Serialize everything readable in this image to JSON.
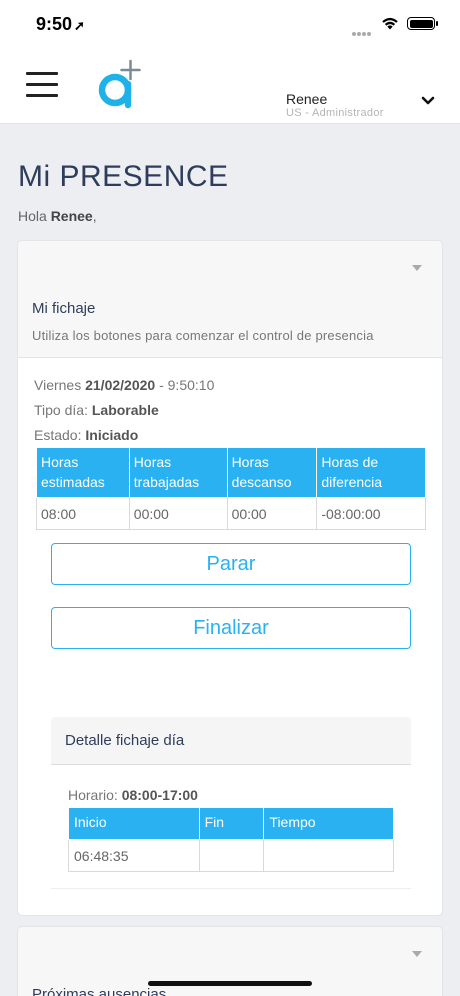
{
  "status_bar": {
    "time": "9:50",
    "location_arrow": "➚"
  },
  "header": {
    "user_name": "Renee",
    "user_role": "US - Administrador",
    "logo_icon": "a-plus-logo",
    "menu_icon": "hamburger-icon",
    "dropdown_icon": "chevron-down-icon"
  },
  "page": {
    "title": "Mi PRESENCE",
    "greeting_prefix": "Hola ",
    "greeting_name": "Renee",
    "greeting_suffix": ","
  },
  "fichaje": {
    "title": "Mi fichaje",
    "subtitle": "Utiliza los botones para comenzar el control de presencia",
    "day_name": "Viernes ",
    "date": "21/02/2020",
    "time_sep": " - ",
    "time": "9:50:10",
    "tipo_label": "Tipo día: ",
    "tipo_value": "Laborable",
    "estado_label": "Estado: ",
    "estado_value": "Iniciado",
    "table": {
      "headers": [
        "Horas estimadas",
        "Horas trabajadas",
        "Horas descanso",
        "Horas de diferencia"
      ],
      "rows": [
        [
          "08:00",
          "00:00",
          "00:00",
          "-08:00:00"
        ]
      ]
    },
    "stop_label": "Parar",
    "finish_label": "Finalizar"
  },
  "detalle": {
    "title": "Detalle fichaje día",
    "horario_label": "Horario: ",
    "horario_value": "08:00-17:00",
    "table": {
      "headers": [
        "Inicio",
        "Fin",
        "Tiempo"
      ],
      "rows": [
        [
          "06:48:35",
          "",
          ""
        ]
      ]
    }
  },
  "ausencias": {
    "title": "Próximas ausencias"
  },
  "colors": {
    "accent": "#29b1f2",
    "title": "#2f3d5c",
    "background": "#eceef1"
  }
}
